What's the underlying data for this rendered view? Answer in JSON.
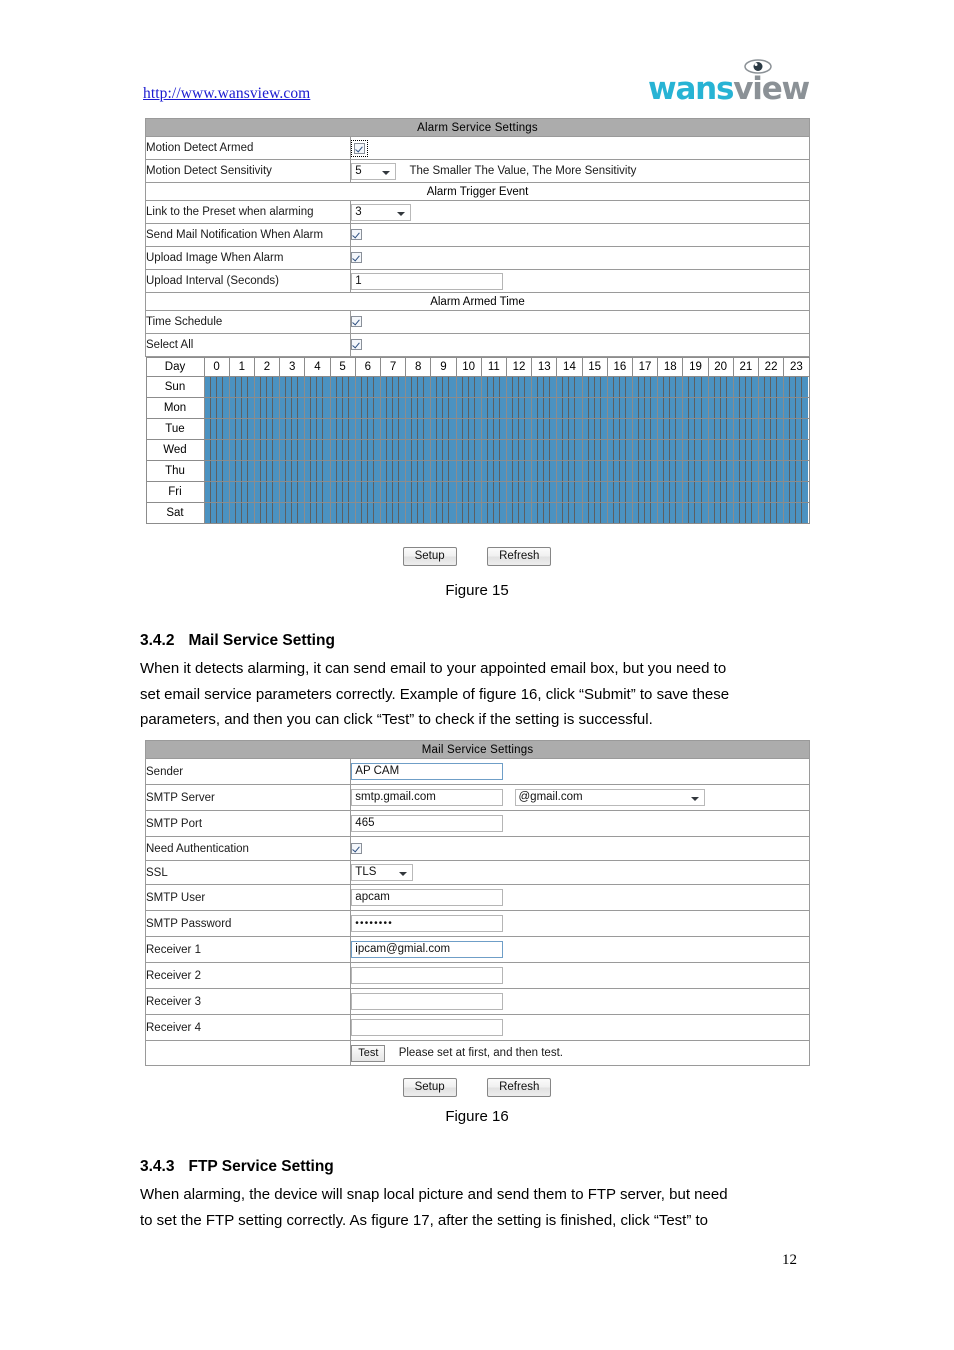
{
  "header": {
    "site_url": "http://www.wansview.com",
    "logo_part1": "wans",
    "logo_part2": "view",
    "logo_color1": "#27b3d4",
    "logo_color2": "#8b9196"
  },
  "alarm_table": {
    "title": "Alarm Service Settings",
    "rows": [
      {
        "label": "Motion Detect Armed",
        "type": "checkbox",
        "checked": true,
        "focused": true
      },
      {
        "label": "Motion Detect Sensitivity",
        "type": "select",
        "value": "5",
        "note": "The Smaller The Value, The More Sensitivity"
      }
    ],
    "section_trigger": "Alarm Trigger Event",
    "trigger_rows": [
      {
        "label": "Link to the Preset when alarming",
        "type": "select",
        "value": "3"
      },
      {
        "label": "Send Mail Notification When Alarm",
        "type": "checkbox",
        "checked": true
      },
      {
        "label": "Upload Image When Alarm",
        "type": "checkbox",
        "checked": true
      },
      {
        "label": "Upload Interval (Seconds)",
        "type": "text",
        "value": "1"
      }
    ],
    "section_armed": "Alarm Armed Time",
    "armed_rows": [
      {
        "label": "Time Schedule",
        "type": "checkbox",
        "checked": true
      },
      {
        "label": "Select All",
        "type": "checkbox",
        "checked": true
      }
    ]
  },
  "schedule": {
    "day_header": "Day",
    "hours": [
      "0",
      "1",
      "2",
      "3",
      "4",
      "5",
      "6",
      "7",
      "8",
      "9",
      "10",
      "11",
      "12",
      "13",
      "14",
      "15",
      "16",
      "17",
      "18",
      "19",
      "20",
      "21",
      "22",
      "23"
    ],
    "days": [
      "Sun",
      "Mon",
      "Tue",
      "Wed",
      "Thu",
      "Fri",
      "Sat"
    ],
    "slots_per_hour": 4,
    "selected_color": "#4b92c1",
    "all_selected": true
  },
  "buttons": {
    "setup": "Setup",
    "refresh": "Refresh",
    "test": "Test"
  },
  "figures": {
    "fig15": "Figure 15",
    "fig16": "Figure 16"
  },
  "section_342": {
    "number": "3.4.2",
    "title": "Mail Service Setting",
    "paragraph_line1": "When it detects alarming, it can send email to your appointed email box, but you need to",
    "paragraph_line2": "set email service parameters correctly. Example of figure 16, click “Submit” to save these",
    "paragraph_line3": "parameters, and then you can click “Test” to check if the setting is successful."
  },
  "mail_table": {
    "title": "Mail Service Settings",
    "rows": [
      {
        "label": "Sender",
        "type": "text",
        "value": "AP CAM",
        "focused": true
      },
      {
        "label": "SMTP Server",
        "type": "text_select",
        "value": "smtp.gmail.com",
        "select_value": "@gmail.com"
      },
      {
        "label": "SMTP Port",
        "type": "text",
        "value": "465"
      },
      {
        "label": "Need Authentication",
        "type": "checkbox",
        "checked": true
      },
      {
        "label": "SSL",
        "type": "select",
        "value": "TLS"
      },
      {
        "label": "SMTP User",
        "type": "text",
        "value": "apcam"
      },
      {
        "label": "SMTP Password",
        "type": "password",
        "value": "••••••••"
      },
      {
        "label": "Receiver 1",
        "type": "text",
        "value": "ipcam@gmial.com",
        "focused": true
      },
      {
        "label": "Receiver 2",
        "type": "text",
        "value": ""
      },
      {
        "label": "Receiver 3",
        "type": "text",
        "value": ""
      },
      {
        "label": "Receiver 4",
        "type": "text",
        "value": ""
      }
    ],
    "test_note": "Please set at first, and then test."
  },
  "section_343": {
    "number": "3.4.3",
    "title": "FTP Service Setting",
    "paragraph_line1": "When alarming, the device will snap local picture and send them to FTP server, but need",
    "paragraph_line2": "to set the FTP setting correctly. As figure 17, after the setting is finished, click “Test” to"
  },
  "footer": {
    "page_number": "12"
  }
}
